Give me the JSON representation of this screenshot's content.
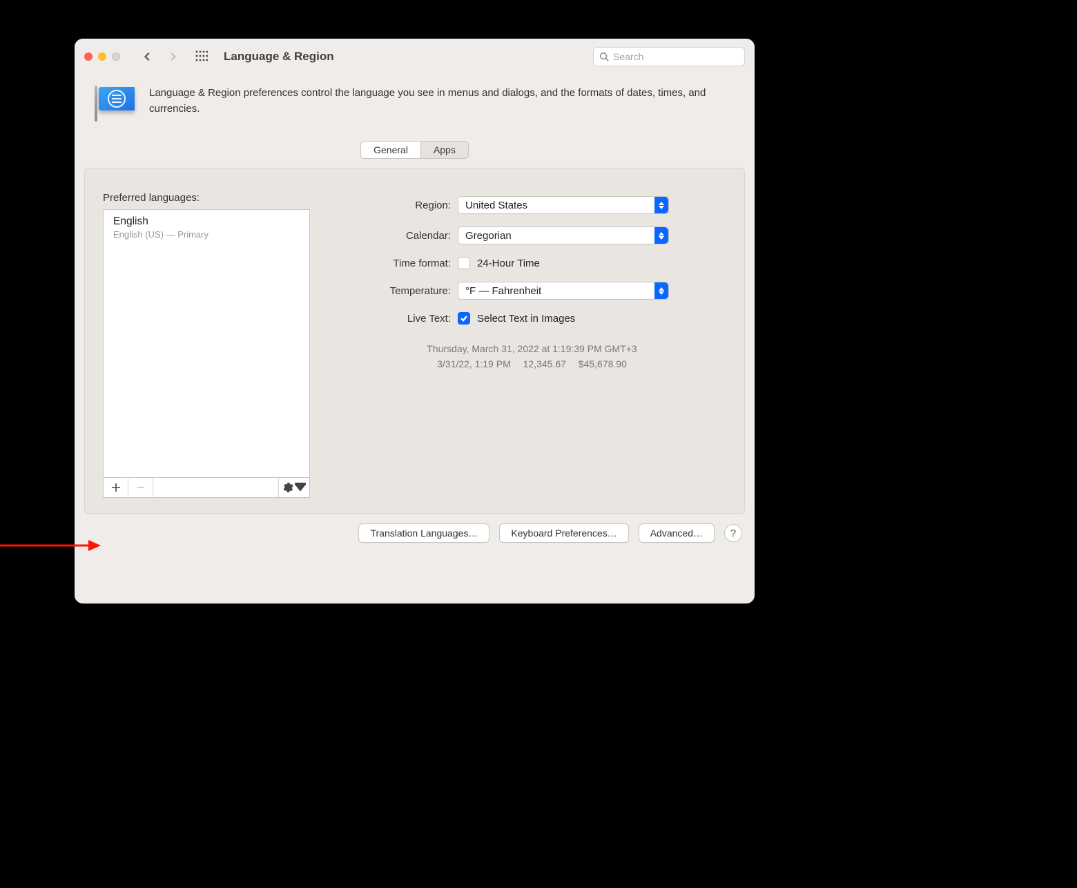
{
  "toolbar": {
    "title": "Language & Region",
    "search_placeholder": "Search"
  },
  "description": "Language & Region preferences control the language you see in menus and dialogs, and the formats of dates, times, and currencies.",
  "tabs": {
    "general": "General",
    "apps": "Apps"
  },
  "left": {
    "heading": "Preferred languages:",
    "items": [
      {
        "name": "English",
        "sub": "English (US) — Primary"
      }
    ]
  },
  "right": {
    "region_label": "Region:",
    "region_value": "United States",
    "calendar_label": "Calendar:",
    "calendar_value": "Gregorian",
    "time_format_label": "Time format:",
    "time_format_value": "24-Hour Time",
    "temperature_label": "Temperature:",
    "temperature_value": "°F — Fahrenheit",
    "live_text_label": "Live Text:",
    "live_text_value": "Select Text in Images",
    "example_line1": "Thursday, March 31, 2022 at 1:19:39 PM GMT+3",
    "example_line2": "3/31/22, 1:19 PM  12,345.67  $45,678.90"
  },
  "bottom": {
    "translation": "Translation Languages…",
    "keyboard": "Keyboard Preferences…",
    "advanced": "Advanced…",
    "help": "?"
  }
}
